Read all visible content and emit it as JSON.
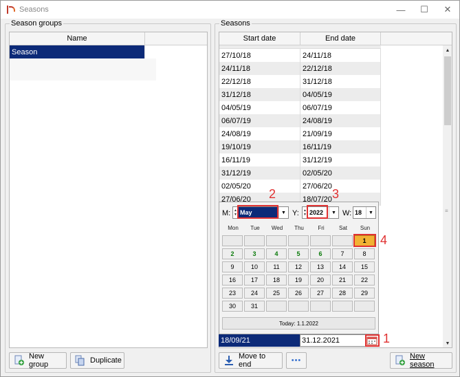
{
  "window": {
    "title": "Seasons",
    "minimize": "—",
    "maximize": "☐",
    "close": "✕"
  },
  "season_groups": {
    "legend": "Season groups",
    "column_name": "Name",
    "rows": [
      "Season"
    ],
    "new_group_label": "New group",
    "duplicate_label": "Duplicate"
  },
  "seasons": {
    "legend": "Seasons",
    "col_start": "Start date",
    "col_end": "End date",
    "rows": [
      [
        "27/10/18",
        "24/11/18"
      ],
      [
        "24/11/18",
        "22/12/18"
      ],
      [
        "22/12/18",
        "31/12/18"
      ],
      [
        "31/12/18",
        "04/05/19"
      ],
      [
        "04/05/19",
        "06/07/19"
      ],
      [
        "06/07/19",
        "24/08/19"
      ],
      [
        "24/08/19",
        "21/09/19"
      ],
      [
        "19/10/19",
        "16/11/19"
      ],
      [
        "16/11/19",
        "31/12/19"
      ],
      [
        "31/12/19",
        "02/05/20"
      ],
      [
        "02/05/20",
        "27/06/20"
      ],
      [
        "27/06/20",
        "18/07/20"
      ]
    ],
    "edit_start": "18/09/21",
    "edit_end": "31.12.2021",
    "move_to_end_label": "Move to end",
    "more_label": "•••",
    "new_season_label": "New season"
  },
  "calendar": {
    "month_label": "M:",
    "month_value": "May",
    "year_label": "Y:",
    "year_value": "2022",
    "week_label": "W:",
    "week_value": "18",
    "weekdays": [
      "Mon",
      "Tue",
      "Wed",
      "Thu",
      "Fri",
      "Sat",
      "Sun"
    ],
    "days": [
      "",
      "",
      "",
      "",
      "",
      "",
      "1",
      "2",
      "3",
      "4",
      "5",
      "6",
      "7",
      "8",
      "9",
      "10",
      "11",
      "12",
      "13",
      "14",
      "15",
      "16",
      "17",
      "18",
      "19",
      "20",
      "21",
      "22",
      "23",
      "24",
      "25",
      "26",
      "27",
      "28",
      "29",
      "30",
      "31",
      "",
      "",
      "",
      "",
      ""
    ],
    "today_label": "Today: 1.1.2022"
  },
  "annotations": [
    "1",
    "2",
    "3",
    "4"
  ],
  "colors": {
    "selection": "#0c2a78",
    "highlight": "#f2b233",
    "annotation": "#e03131",
    "weekday_green": "#0a7a0a"
  }
}
